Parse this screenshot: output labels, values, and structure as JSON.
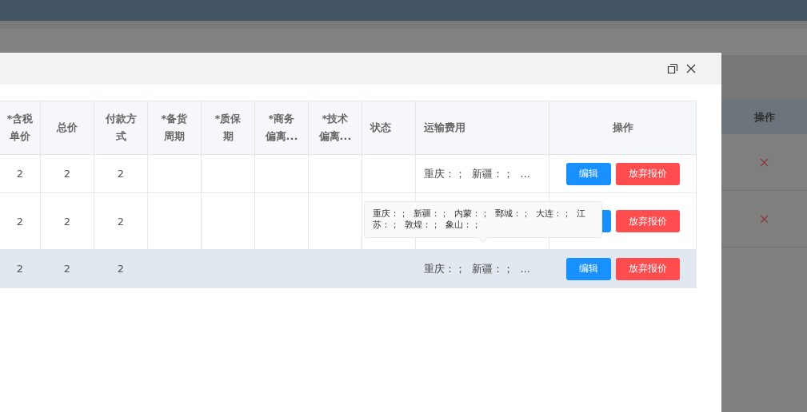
{
  "backdrop": {
    "table": {
      "columns": [
        "操作"
      ],
      "rows": [
        {
          "kind": "delete"
        },
        {
          "kind": "delete"
        }
      ]
    }
  },
  "dialog": {
    "controls": [
      {
        "kind": "restore"
      },
      {
        "kind": "close"
      }
    ],
    "table": {
      "columns": [
        "*含税单价",
        "总价",
        "付款方式",
        "*备货周期",
        "*质保期",
        "*商务偏离...",
        "*技术偏离...",
        "状态",
        "运输费用",
        "操作"
      ],
      "rows": [
        {
          "unit_price": "2",
          "total": "2",
          "payment": "2",
          "transport": "重庆：；  新疆：；  ...",
          "highlighted": false,
          "actions": [
            {
              "kind": "edit",
              "label": "编辑"
            },
            {
              "kind": "abandon",
              "label": "放弃报价"
            }
          ]
        },
        {
          "unit_price": "2",
          "total": "2",
          "payment": "2",
          "highlighted": false,
          "tooltip": "重庆：；  新疆：；  内蒙：；  鄄城：；  大连：；  江苏：；  敦煌：；  象山：；",
          "actions": [
            {
              "kind": "edit"
            },
            {
              "kind": "abandon",
              "label": "放弃报价"
            }
          ]
        },
        {
          "unit_price": "2",
          "total": "2",
          "payment": "2",
          "transport": "重庆：；  新疆：；  ...",
          "highlighted": true,
          "actions": [
            {
              "kind": "edit",
              "label": "编辑"
            },
            {
              "kind": "abandon",
              "label": "放弃报价"
            }
          ]
        }
      ]
    }
  }
}
